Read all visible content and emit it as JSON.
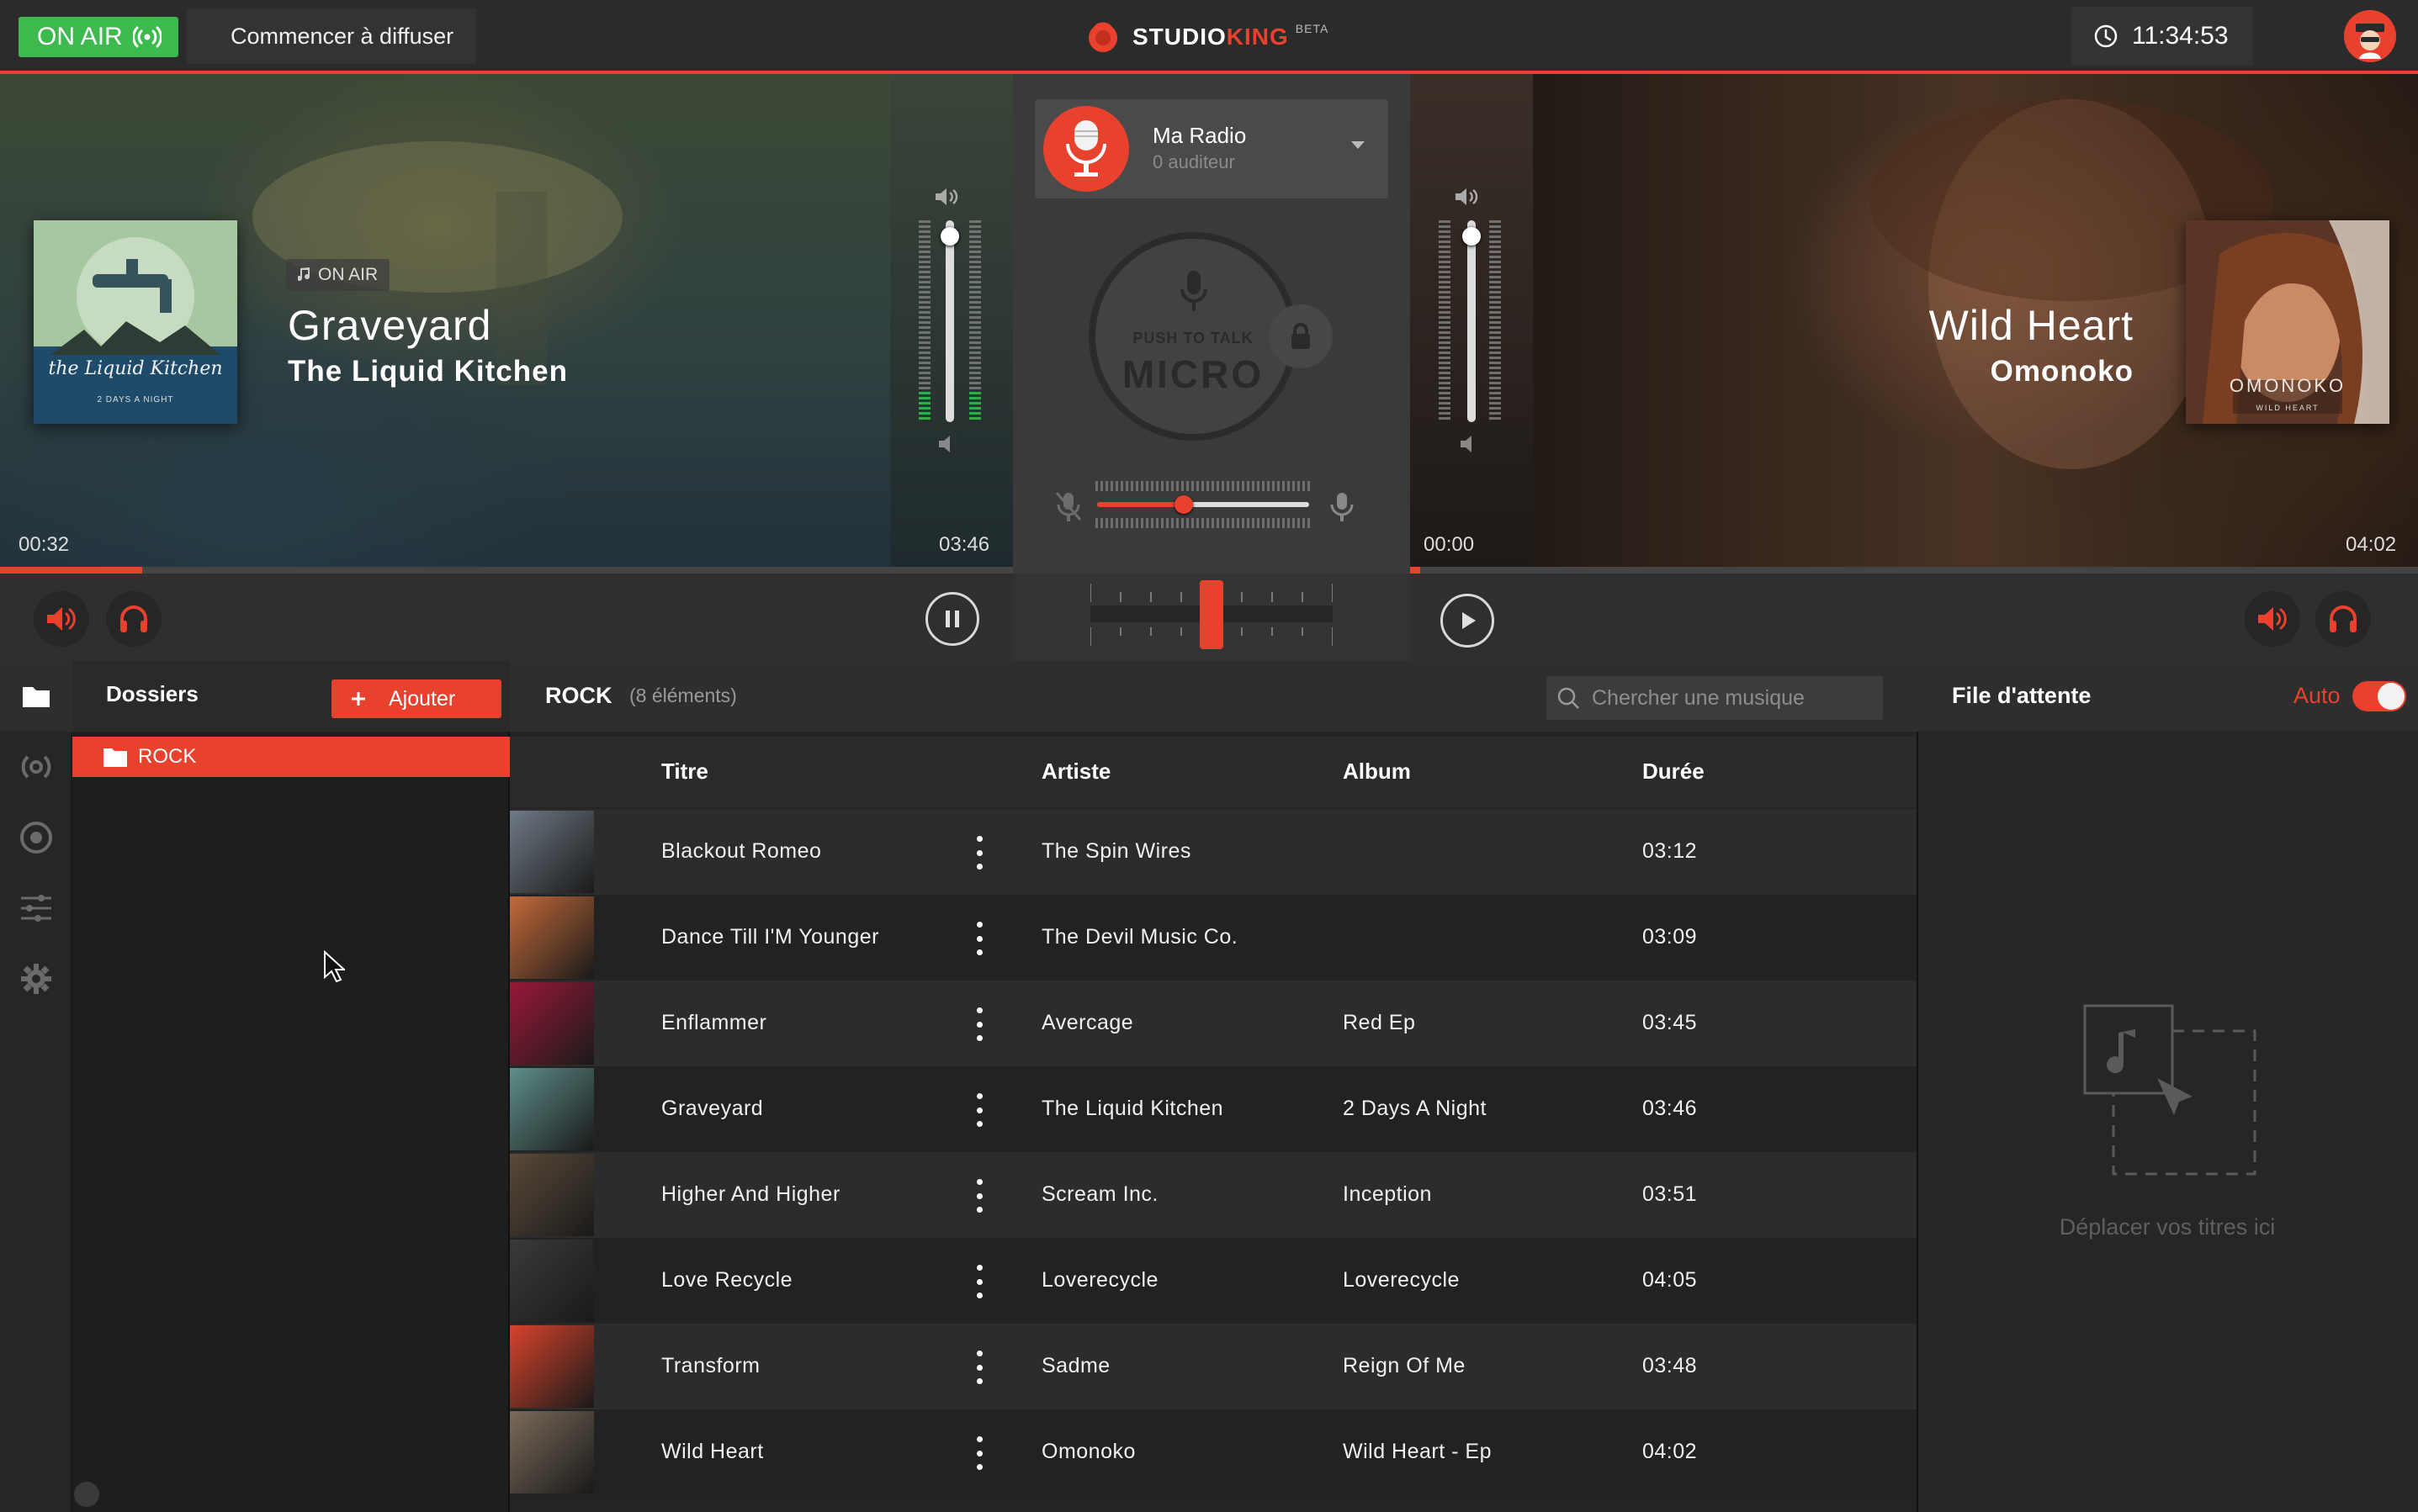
{
  "topbar": {
    "onair_label": "ON AIR",
    "start_label": "Commencer à diffuser",
    "logo_studio": "STUDIO",
    "logo_king": "KING",
    "logo_beta": "BETA",
    "clock": "11:34:53",
    "accent": "#e8412d",
    "onair_color": "#3dba4e"
  },
  "deckA": {
    "badge": "ON AIR",
    "title": "Graveyard",
    "artist": "The Liquid Kitchen",
    "time_current": "00:32",
    "time_total": "03:46",
    "progress": 0.14,
    "volume": 0.95,
    "cover_text": "the Liquid Kitchen",
    "cover_sub": "2 DAYS A NIGHT"
  },
  "deckB": {
    "title": "Wild Heart",
    "artist": "Omonoko",
    "time_current": "00:00",
    "time_total": "04:02",
    "progress": 0.0,
    "volume": 0.95,
    "cover_text": "OMONOKO",
    "cover_sub": "WILD HEART"
  },
  "mixer": {
    "radio_name": "Ma Radio",
    "listeners": "0 auditeur",
    "ptt_sub": "PUSH TO TALK",
    "ptt_main": "MICRO",
    "mic_level": 0.41,
    "crossfader": 0.5
  },
  "sidebar": {
    "icons": [
      "folder-icon",
      "broadcast-icon",
      "record-icon",
      "sliders-icon",
      "gear-icon"
    ]
  },
  "folders": {
    "title": "Dossiers",
    "add_label": "Ajouter",
    "items": [
      {
        "label": "ROCK"
      }
    ]
  },
  "list": {
    "title": "ROCK",
    "count": "(8 éléments)",
    "search_placeholder": "Chercher une musique",
    "columns": {
      "title": "Titre",
      "artist": "Artiste",
      "album": "Album",
      "duration": "Durée"
    },
    "rows": [
      {
        "title": "Blackout Romeo",
        "artist": "The Spin Wires",
        "album": "",
        "duration": "03:12",
        "color": "#6f7a86"
      },
      {
        "title": "Dance Till I'M Younger",
        "artist": "The Devil Music Co.",
        "album": "",
        "duration": "03:09",
        "color": "#c46a3a"
      },
      {
        "title": "Enflammer",
        "artist": "Avercage",
        "album": "Red Ep",
        "duration": "03:45",
        "color": "#9a1838"
      },
      {
        "title": "Graveyard",
        "artist": "The Liquid Kitchen",
        "album": "2 Days A Night",
        "duration": "03:46",
        "color": "#5e8e8a"
      },
      {
        "title": "Higher And Higher",
        "artist": "Scream Inc.",
        "album": "Inception",
        "duration": "03:51",
        "color": "#5a4a3a"
      },
      {
        "title": "Love Recycle",
        "artist": "Loverecycle",
        "album": "Loverecycle",
        "duration": "04:05",
        "color": "#3a3a3a"
      },
      {
        "title": "Transform",
        "artist": "Sadme",
        "album": "Reign Of Me",
        "duration": "03:48",
        "color": "#d8432c"
      },
      {
        "title": "Wild Heart",
        "artist": "Omonoko",
        "album": "Wild Heart - Ep",
        "duration": "04:02",
        "color": "#7a6a5a"
      }
    ]
  },
  "queue": {
    "title": "File d'attente",
    "auto_label": "Auto",
    "auto_on": true,
    "drop_text": "Déplacer vos titres ici"
  }
}
